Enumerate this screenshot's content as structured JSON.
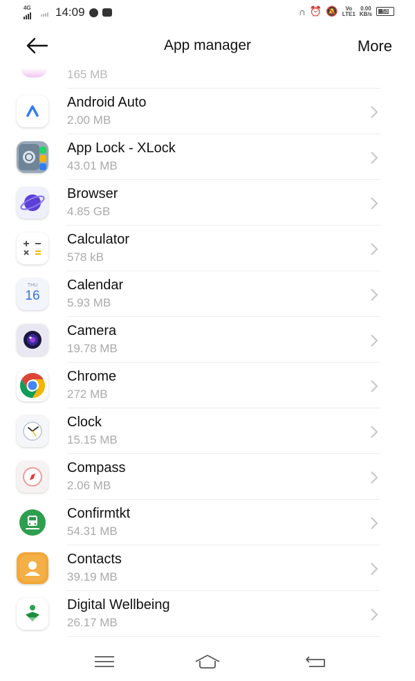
{
  "status_bar": {
    "network_label": "4G",
    "time": "14:09",
    "volte_label": "Vo",
    "lte_label": "LTE1",
    "speed_value": "0.00",
    "speed_unit": "KB/s",
    "battery_level": "58"
  },
  "header": {
    "title": "App manager",
    "more_label": "More"
  },
  "list": {
    "partial_item_size": "165 MB",
    "items": [
      {
        "name": "Android Auto",
        "size": "2.00 MB",
        "icon": "android-auto-icon"
      },
      {
        "name": "App Lock - XLock",
        "size": "43.01 MB",
        "icon": "app-lock-icon"
      },
      {
        "name": "Browser",
        "size": "4.85 GB",
        "icon": "browser-icon"
      },
      {
        "name": "Calculator",
        "size": "578 kB",
        "icon": "calculator-icon"
      },
      {
        "name": "Calendar",
        "size": "5.93 MB",
        "icon": "calendar-icon"
      },
      {
        "name": "Camera",
        "size": "19.78 MB",
        "icon": "camera-icon"
      },
      {
        "name": "Chrome",
        "size": "272 MB",
        "icon": "chrome-icon"
      },
      {
        "name": "Clock",
        "size": "15.15 MB",
        "icon": "clock-icon"
      },
      {
        "name": "Compass",
        "size": "2.06 MB",
        "icon": "compass-icon"
      },
      {
        "name": "Confirmtkt",
        "size": "54.31 MB",
        "icon": "confirmtkt-icon"
      },
      {
        "name": "Contacts",
        "size": "39.19 MB",
        "icon": "contacts-icon"
      },
      {
        "name": "Digital Wellbeing",
        "size": "26.17 MB",
        "icon": "digital-wellbeing-icon"
      }
    ],
    "calendar_icon_day": "THU",
    "calendar_icon_date": "16"
  },
  "colors": {
    "text_primary": "#111111",
    "text_secondary": "#aaaaaa",
    "chevron": "#c4c4c4",
    "divider": "#ededed"
  }
}
